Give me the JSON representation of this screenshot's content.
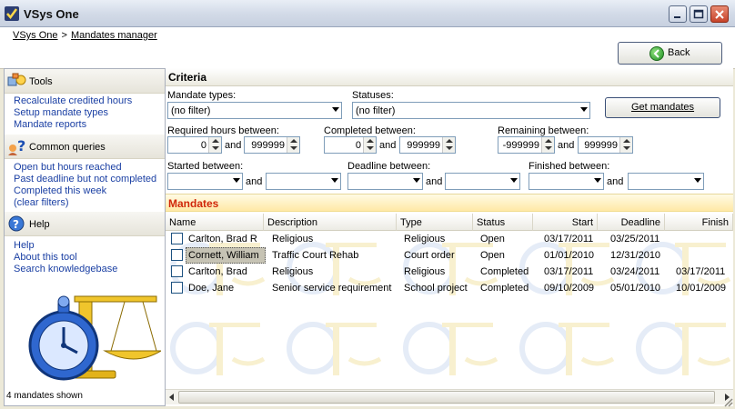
{
  "window": {
    "title": "VSys One"
  },
  "breadcrumb": {
    "home": "VSys One",
    "separator": ">",
    "current": "Mandates manager"
  },
  "back_button": {
    "label": "Back"
  },
  "sidebar": {
    "tools": {
      "title": "Tools",
      "items": [
        "Recalculate credited hours",
        "Setup mandate types",
        "Mandate reports"
      ]
    },
    "queries": {
      "title": "Common queries",
      "items": [
        "Open but hours reached",
        "Past deadline but not completed",
        "Completed this week",
        "(clear filters)"
      ]
    },
    "help": {
      "title": "Help",
      "items": [
        "Help",
        "About this tool",
        "Search knowledgebase"
      ]
    },
    "status": "4 mandates shown"
  },
  "criteria": {
    "title": "Criteria",
    "mandate_types": {
      "label": "Mandate types:",
      "value": "(no filter)"
    },
    "statuses": {
      "label": "Statuses:",
      "value": "(no filter)"
    },
    "get_button": "Get mandates",
    "and": "and",
    "required_hours": {
      "label": "Required hours between:",
      "from": "0",
      "to": "999999"
    },
    "completed": {
      "label": "Completed between:",
      "from": "0",
      "to": "999999"
    },
    "remaining": {
      "label": "Remaining between:",
      "from": "-999999",
      "to": "999999"
    },
    "started": {
      "label": "Started between:",
      "from": "",
      "to": ""
    },
    "deadline": {
      "label": "Deadline between:",
      "from": "",
      "to": ""
    },
    "finished": {
      "label": "Finished between:",
      "from": "",
      "to": ""
    }
  },
  "mandates": {
    "title": "Mandates",
    "columns": [
      "Name",
      "Description",
      "Type",
      "Status",
      "Start",
      "Deadline",
      "Finish"
    ],
    "rows": [
      {
        "name": "Carlton, Brad R",
        "description": "Religious",
        "type": "Religious",
        "status": "Open",
        "start": "03/17/2011",
        "deadline": "03/25/2011",
        "finish": ""
      },
      {
        "name": "Cornett, William",
        "description": "Traffic Court Rehab",
        "type": "Court order",
        "status": "Open",
        "start": "01/01/2010",
        "deadline": "12/31/2010",
        "finish": ""
      },
      {
        "name": "Carlton, Brad",
        "description": "Religious",
        "type": "Religious",
        "status": "Completed",
        "start": "03/17/2011",
        "deadline": "03/24/2011",
        "finish": "03/17/2011"
      },
      {
        "name": "Doe, Jane",
        "description": "Senior service requirement",
        "type": "School project",
        "status": "Completed",
        "start": "09/10/2009",
        "deadline": "05/01/2010",
        "finish": "10/01/2009"
      }
    ],
    "selected_row": 1
  },
  "colors": {
    "mandates_header_text": "#d0270a",
    "link": "#1a3fa3",
    "selection": "#c6c3b4"
  }
}
